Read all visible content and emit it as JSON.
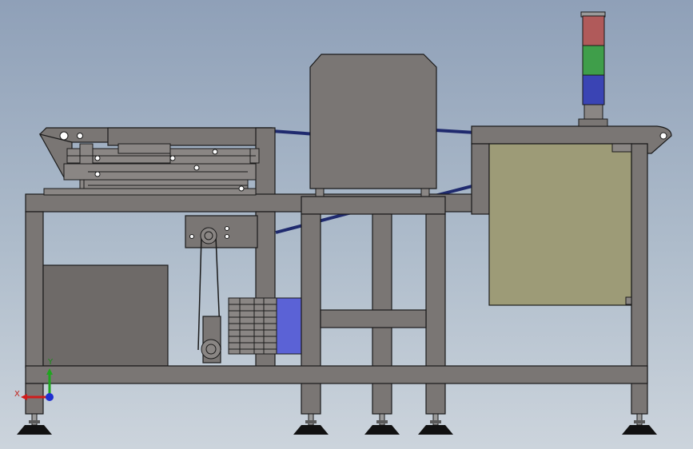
{
  "axis_triad": {
    "x_label": "X",
    "y_label": "Y",
    "colors": {
      "x": "#d01c1c",
      "y": "#1fa51f",
      "z": "#1f2fd0"
    }
  },
  "signal_tower": {
    "segments": [
      {
        "color": "#b05a5a",
        "name": "red-light"
      },
      {
        "color": "#3f9e4a",
        "name": "green-light"
      },
      {
        "color": "#3a44b4",
        "name": "blue-light"
      }
    ]
  },
  "colors": {
    "frame": "#7a7674",
    "reject_panel": "#9d9b77",
    "motor": "#5b62d6",
    "belt": "#1f2a6e"
  },
  "drawing_view": "front elevation"
}
